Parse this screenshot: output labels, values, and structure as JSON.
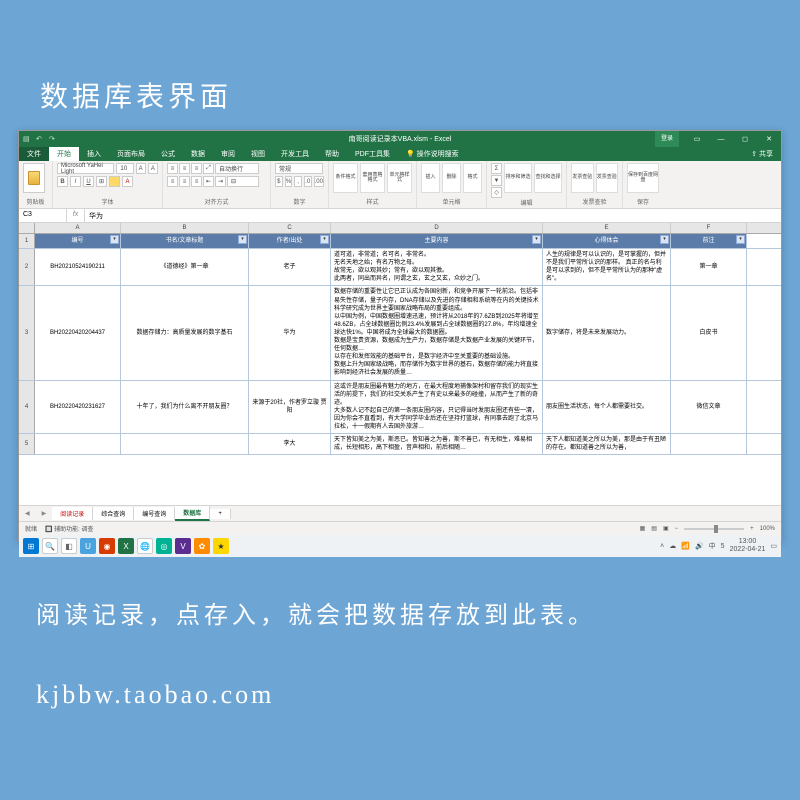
{
  "page": {
    "title": "数据库表界面",
    "caption1": "阅读记录，点存入，就会把数据存放到此表。",
    "caption2": "kjbbw.taobao.com"
  },
  "titlebar": {
    "filename": "南哥阅读记录本VBA.xlsm - Excel",
    "login": "登录"
  },
  "tabs": {
    "file": "文件",
    "home": "开始",
    "insert": "插入",
    "layout": "页面布局",
    "formulas": "公式",
    "data": "数据",
    "review": "审阅",
    "view": "视图",
    "dev": "开发工具",
    "help": "帮助",
    "pdf": "PDF工具集",
    "tell": "操作说明搜索",
    "share": "共享"
  },
  "ribbon": {
    "paste": "粘贴",
    "clipboard": "剪贴板",
    "font_name": "Microsoft YaHei Light",
    "font_size": "10",
    "font_group": "字体",
    "align_group": "对齐方式",
    "wrap": "自动换行",
    "merge": "合并后居中",
    "num_format": "常规",
    "number_group": "数字",
    "cond_fmt": "条件格式",
    "table_fmt": "套用表格格式",
    "cell_styles": "单元格样式",
    "styles_group": "样式",
    "insert_btn": "插入",
    "delete_btn": "删除",
    "format_btn": "格式",
    "cells_group": "单元格",
    "sort_filter": "排序和筛选",
    "find_sel": "查找和选择",
    "edit_group": "编辑",
    "inv1": "发票查验",
    "inv2": "发票查验",
    "inv_group": "发票查验",
    "save_cloud": "保存到百度网盘",
    "save_group": "保存"
  },
  "formula": {
    "cell_ref": "C3",
    "value": "华为"
  },
  "columns": [
    "A",
    "B",
    "C",
    "D",
    "E",
    "F"
  ],
  "headers": [
    "编号",
    "书名/文章标题",
    "作者/出处",
    "主要内容",
    "心得体会",
    "前注"
  ],
  "rows": [
    {
      "n": "2",
      "id": "BH20210524190211",
      "title": "《道德经》第一章",
      "author": "老子",
      "content": "道可道，非常道；名可名，非常名。\n无名天地之始；有名万物之母。\n故常无，欲以观其妙；常有，欲以观其徼。\n此两者，同出而异名，同谓之玄，玄之又玄，众妙之门。",
      "notes": "人生的规律是可以认识的，是可掌握的，但并不是我们平常所认识的那样。\n真正的名与利是可以求到的，但不是平常所认为的那种\"虚名\"。",
      "remark": "第一章"
    },
    {
      "n": "3",
      "id": "BH20220420204437",
      "title": "数据存储力：高质量发展的数字基石",
      "author": "华为",
      "content": "数据存储的重要性让它已正认成为各国创新，和竞争开展下一轮前沿。包括非易失性存储，量子内存，DNA存储以及先进的存储相和系统等在内的关键技术科学研究成为世界主要国家战略布局的重要组成。\n以中国为例，中国数据圈增速迅速，预计将从2018年的7.6ZB到2025年将增至48.6ZB，占全球数据圈比例23.4%发展到占全球数据圈的27.8%，年均增速全球达快1%。中国将成为全球最大的数据圈。\n数据是宝贵资源，数据成为生产力，数据存储是大数据产业发展的关键环节，任何数据…\n以存在和发挥效能的基础平台，是数字经济中至关重要的基础设施。\n数据上升为国家级战略，而存储作为数字世界的基石，数据存储的能力将直接影响到经济社会发展的质量…",
      "notes": "数字储存，将是未来发展动力。",
      "remark": "白皮书"
    },
    {
      "n": "4",
      "id": "BH20220420231627",
      "title": "十年了，我们为什么离不开朋友圈？",
      "author": "来源于20社，作者罗立璇 贾阳",
      "content": "这或许是朋友圈最有魅力的地方，在最大程度地捕像架村和留存我们的现实生活的前提下，我们的社交关系产生了有史以来最多的碰撞，从而产生了新的奇迹。\n大多数人记不起自己的第一条朋友圈内容，只记得当时发朋友圈还有些一凟，因为你会不直看到，有大学同学毕业后还在坚持打篮球，有同事去跑了北京马拉松，十一假期有人去国外旅游…",
      "notes": "朋友圈生活状态，每个人都需要社交。",
      "remark": "微信文章"
    },
    {
      "n": "5",
      "id": "",
      "title": "",
      "author": "李大",
      "content": "天下皆知美之为美，斯恶已。皆知善之为善，斯不善已，有无相生，难易相成，长短相形，高下相盈，音声相和，前后相随…",
      "notes": "天下人都知道美之所以为美，那是由于有丑陋的存在。都知道善之所以为善，",
      "remark": ""
    }
  ],
  "sheets": {
    "s1": "阅读记录",
    "s2": "综合查询",
    "s3": "编号查询",
    "s4": "数据库",
    "new": "+"
  },
  "status": {
    "ready": "就绪",
    "aux": "辅助功能: 调查",
    "zoom": "100%"
  },
  "tray": {
    "ime": "中",
    "net": "5",
    "time": "13:00",
    "date": "2022-04-21"
  }
}
